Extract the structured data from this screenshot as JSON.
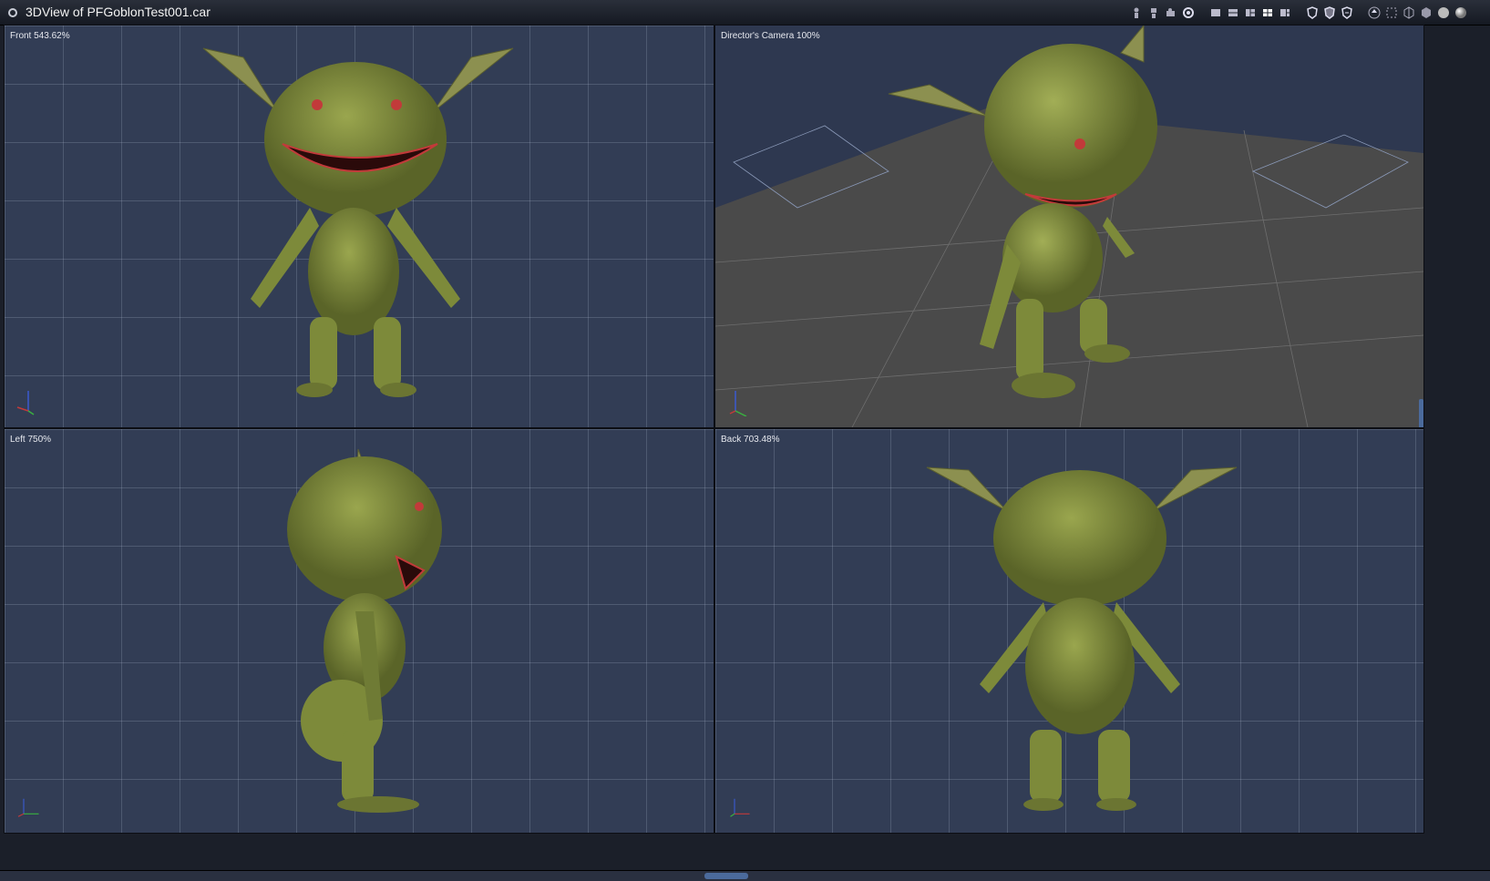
{
  "window": {
    "title": "3DView of PFGoblonTest001.car"
  },
  "toolbar": {
    "icons": [
      "figure-icon",
      "prop-icon",
      "camera-icon",
      "gear-icon",
      "layout-single-icon",
      "layout-two-icon",
      "layout-three-icon",
      "layout-four-icon",
      "layout-wide-icon",
      "shield-left-icon",
      "shield-both-icon",
      "shield-right-icon",
      "upload-icon",
      "dotted-box-icon",
      "wire-box-icon",
      "solid-box-icon",
      "sphere-shaded-icon",
      "sphere-lit-icon"
    ]
  },
  "viewports": {
    "front": {
      "label": "Front 543.62%"
    },
    "camera": {
      "label": "Director's Camera 100%"
    },
    "left": {
      "label": "Left 750%"
    },
    "back": {
      "label": "Back 703.48%"
    }
  },
  "colors": {
    "viewport_bg": "#323d55",
    "skin": "#7d8a3a",
    "eye": "#c23a3a",
    "floor": "#4a4a4a"
  }
}
